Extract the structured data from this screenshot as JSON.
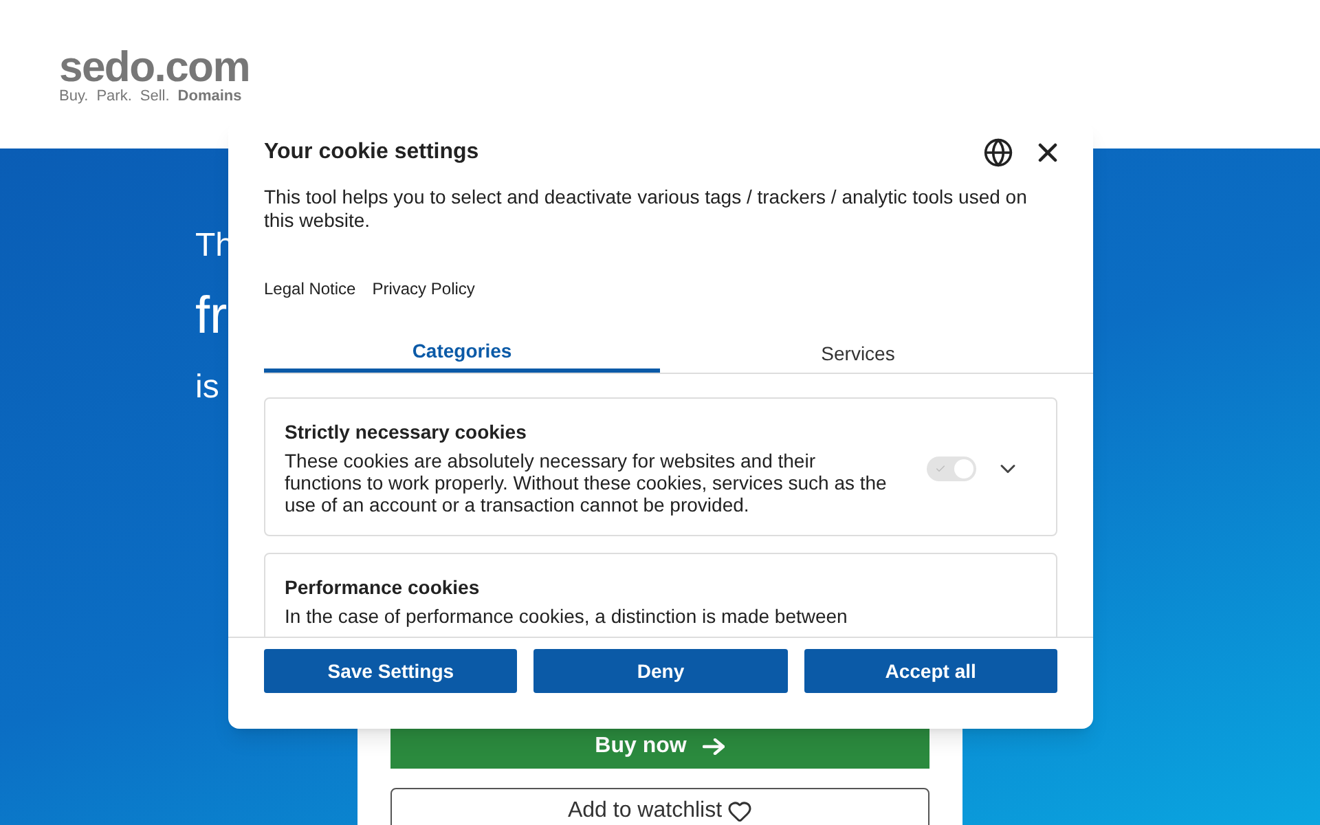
{
  "header": {
    "logo": "sedo.com",
    "tagline_parts": [
      {
        "text": "Buy.",
        "bold": false
      },
      {
        "text": "Park.",
        "bold": false
      },
      {
        "text": "Sell.",
        "bold": false
      },
      {
        "text": "Domains",
        "bold": true
      }
    ]
  },
  "hero": {
    "lines": [
      "Th",
      "fr",
      "is"
    ]
  },
  "offer_card": {
    "buy_button": "Buy now",
    "watchlist_button": "Add to watchlist"
  },
  "cookie_dialog": {
    "title": "Your cookie settings",
    "description": "This tool helps you to select and deactivate various tags / trackers / analytic tools used on this website.",
    "links": [
      "Legal Notice",
      "Privacy Policy"
    ],
    "tabs": [
      {
        "label": "Categories",
        "selected": true
      },
      {
        "label": "Services",
        "selected": false
      }
    ],
    "categories": [
      {
        "title": "Strictly necessary cookies",
        "description": "These cookies are absolutely necessary for websites and their functions to work properly. Without these cookies, services such as the use of an account or a transaction cannot be provided.",
        "on": true,
        "disabled": true
      },
      {
        "title": "Performance cookies",
        "description": "In the case of performance cookies, a distinction is made between"
      }
    ],
    "buttons": [
      "Save Settings",
      "Deny",
      "Accept all"
    ]
  }
}
